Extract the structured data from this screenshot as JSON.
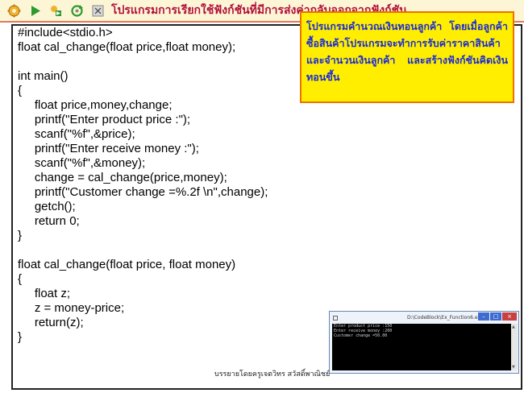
{
  "toolbar": {
    "title": "โปรแกรมการเรียกใช้ฟังก์ชันที่มีการส่งค่ากลับออกจากฟังก์ชัน",
    "icons": [
      "gear-icon",
      "play-icon",
      "runner-icon",
      "refresh-icon",
      "close-icon"
    ],
    "colors": {
      "title": "#b0103a",
      "bar": "#fdf6d6"
    }
  },
  "code": {
    "lines": [
      "#include<stdio.h>",
      "float cal_change(float price,float money);",
      "",
      "int main()",
      "{",
      "     float price,money,change;",
      "     printf(\"Enter product price :\");",
      "     scanf(\"%f\",&price);",
      "     printf(\"Enter receive money :\");",
      "     scanf(\"%f\",&money);",
      "     change = cal_change(price,money);",
      "     printf(\"Customer change =%.2f \\n\",change);",
      "     getch();",
      "     return 0;",
      "}",
      "",
      "float cal_change(float price, float money)",
      "{",
      "     float z;",
      "     z = money-price;",
      "     return(z);",
      "}"
    ]
  },
  "note": {
    "text": "โปรแกรมคำนวณเงินทอนลูกค้า โดยเมื่อลูกค้าซื้อสินค้าโปรแกรมจะทำการรับค่าราคาสินค้า และจำนวนเงินลูกค้า และสร้างฟังก์ชันคิดเงินทอนขึ้น",
    "colors": {
      "background": "#ffee00",
      "border": "#f07000",
      "text": "#1a2bd6"
    }
  },
  "credit": "บรรยายโดยครูเจตวิทร สวัสดิ์พาณิชย์",
  "console": {
    "title": "D:\\CodeBlock\\Ex_Function6.exe",
    "output": [
      "Enter product price :150",
      "Enter receive money :200",
      "Customer change =50.00"
    ],
    "buttons": {
      "minimize": "–",
      "maximize": "□",
      "close": "×"
    }
  }
}
